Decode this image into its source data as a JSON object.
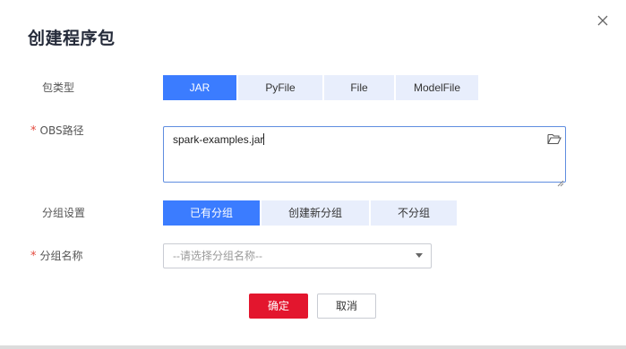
{
  "dialog": {
    "title": "创建程序包"
  },
  "form": {
    "package_type": {
      "label": "包类型",
      "options": [
        "JAR",
        "PyFile",
        "File",
        "ModelFile"
      ],
      "selected": "JAR"
    },
    "obs_path": {
      "required_mark": "*",
      "label": "OBS路径",
      "value": "spark-examples.jar"
    },
    "group_setting": {
      "label": "分组设置",
      "options": [
        "已有分组",
        "创建新分组",
        "不分组"
      ],
      "selected": "已有分组"
    },
    "group_name": {
      "required_mark": "*",
      "label": "分组名称",
      "placeholder": "--请选择分组名称--"
    }
  },
  "actions": {
    "confirm_label": "确定",
    "cancel_label": "取消"
  },
  "colors": {
    "accent": "#3b7cff",
    "segment_bg": "#e8eefc",
    "confirm": "#e3162e",
    "required": "#e34a3f"
  },
  "icons": [
    "close-icon",
    "folder-icon",
    "resize-handle-icon",
    "dropdown-arrow-icon"
  ]
}
